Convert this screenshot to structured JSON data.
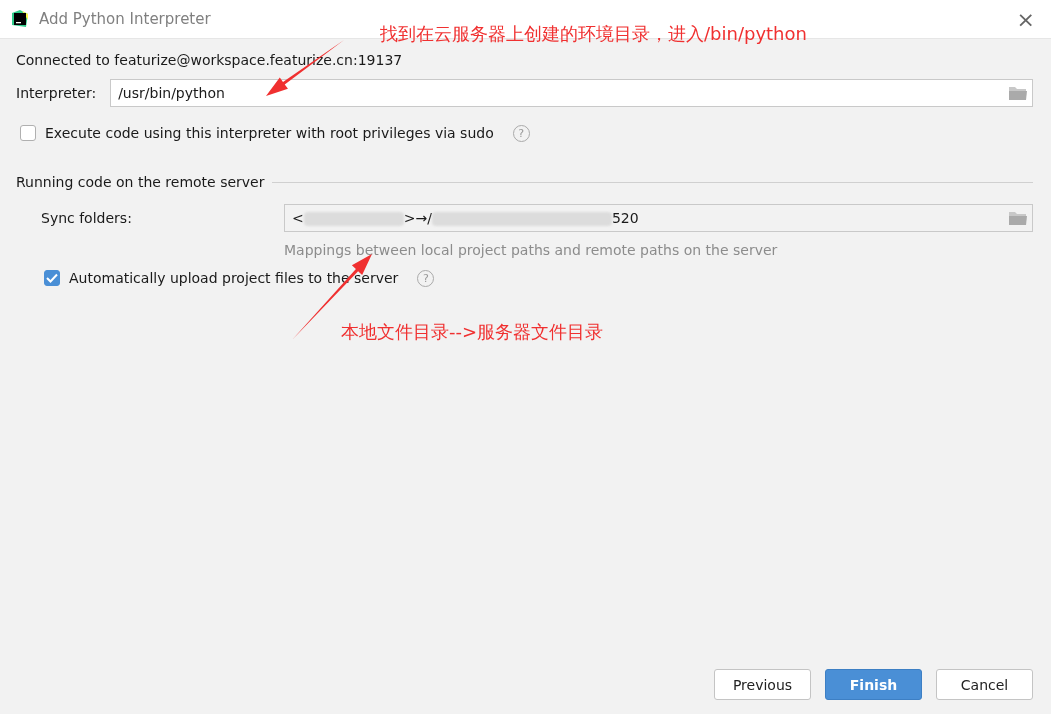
{
  "window": {
    "title": "Add Python Interpreter",
    "close": "×"
  },
  "connection": "Connected to featurize@workspace.featurize.cn:19137",
  "interpreter": {
    "label": "Interpreter:",
    "value": "/usr/bin/python"
  },
  "sudo": {
    "label": "Execute code using this interpreter with root privileges via sudo",
    "checked": false,
    "help": "?"
  },
  "section": {
    "title": "Running code on the remote server"
  },
  "sync_folders": {
    "label": "Sync folders:",
    "value_parts": [
      "<",
      ">→/",
      "520"
    ],
    "hint": "Mappings between local project paths and remote paths on the server"
  },
  "auto_upload": {
    "label": "Automatically upload project files to the server",
    "checked": true,
    "help": "?"
  },
  "annotations": [
    "找到在云服务器上创建的环境目录，进入/bin/python",
    "本地文件目录-->服务器文件目录"
  ],
  "buttons": [
    {
      "label": "Previous",
      "primary": false
    },
    {
      "label": "Finish",
      "primary": true
    },
    {
      "label": "Cancel",
      "primary": false
    }
  ]
}
